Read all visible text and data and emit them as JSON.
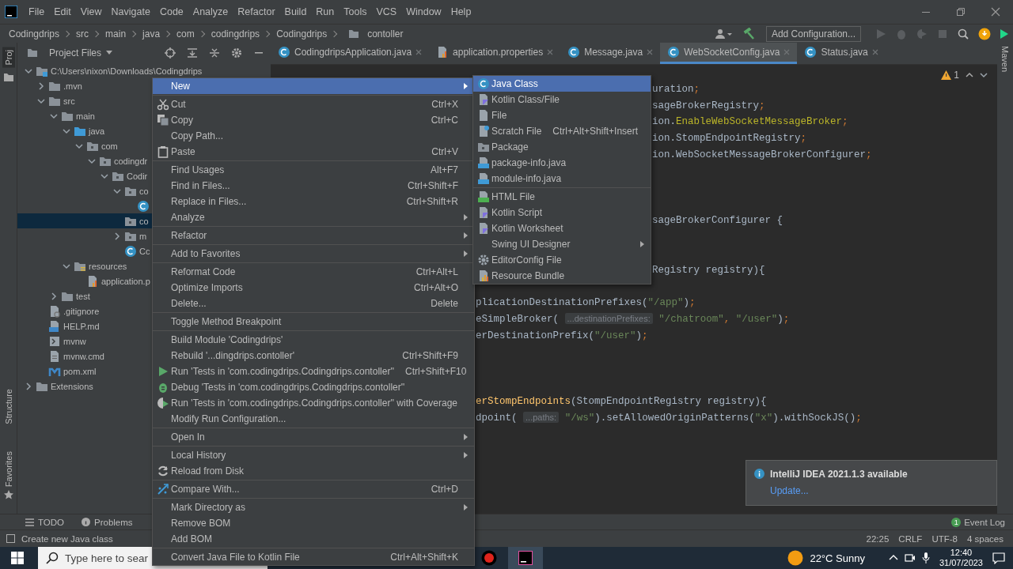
{
  "title_bar": {
    "menus": [
      "File",
      "Edit",
      "View",
      "Navigate",
      "Code",
      "Analyze",
      "Refactor",
      "Build",
      "Run",
      "Tools",
      "VCS",
      "Window",
      "Help"
    ]
  },
  "nav_bar": {
    "breadcrumb": [
      "Codingdrips",
      "src",
      "main",
      "java",
      "com",
      "codingdrips",
      "Codingdrips",
      "contoller"
    ],
    "run_config": "Add Configuration..."
  },
  "side_tabs": {
    "left": [
      "Proj",
      "Structure",
      "Favorites"
    ],
    "right": [
      "Maven"
    ]
  },
  "project_panel": {
    "title": "Project Files",
    "tree": [
      {
        "label": "C:\\Users\\nixon\\Downloads\\Codingdrips",
        "kind": "module",
        "expanded": true,
        "selected": false,
        "children": [
          {
            "label": ".mvn",
            "kind": "folder",
            "expanded": false,
            "selected": false
          },
          {
            "label": "src",
            "kind": "folder",
            "expanded": true,
            "selected": false,
            "children": [
              {
                "label": "main",
                "kind": "folder",
                "expanded": true,
                "selected": false,
                "children": [
                  {
                    "label": "java",
                    "kind": "source_folder",
                    "expanded": true,
                    "selected": false,
                    "children": [
                      {
                        "label": "com",
                        "kind": "package",
                        "expanded": true,
                        "selected": false,
                        "children": [
                          {
                            "label": "codingdr",
                            "kind": "package",
                            "expanded": true,
                            "selected": false,
                            "children": [
                              {
                                "label": "Codir",
                                "kind": "package",
                                "expanded": true,
                                "selected": false,
                                "children": [
                                  {
                                    "label": "co",
                                    "kind": "package",
                                    "expanded": true,
                                    "selected": false,
                                    "children": [
                                      {
                                        "kind": "class",
                                        "selected": false
                                      }
                                    ]
                                  },
                                  {
                                    "label": "co",
                                    "kind": "package",
                                    "selected": true
                                  },
                                  {
                                    "label": "m",
                                    "kind": "package",
                                    "expanded": false,
                                    "selected": false
                                  },
                                  {
                                    "label": "Cc",
                                    "kind": "class",
                                    "selected": false
                                  }
                                ]
                              }
                            ]
                          }
                        ]
                      }
                    ]
                  },
                  {
                    "label": "resources",
                    "kind": "resources",
                    "expanded": true,
                    "selected": false,
                    "children": [
                      {
                        "label": "application.p",
                        "kind": "properties",
                        "selected": false
                      }
                    ]
                  }
                ]
              },
              {
                "label": "test",
                "kind": "folder",
                "expanded": false,
                "selected": false
              }
            ]
          },
          {
            "label": ".gitignore",
            "kind": "ignore",
            "selected": false
          },
          {
            "label": "HELP.md",
            "kind": "markdown",
            "selected": false
          },
          {
            "label": "mvnw",
            "kind": "script",
            "selected": false
          },
          {
            "label": "mvnw.cmd",
            "kind": "text",
            "selected": false
          },
          {
            "label": "pom.xml",
            "kind": "maven",
            "selected": false
          }
        ]
      },
      {
        "label": "Extensions",
        "kind": "folder",
        "expanded": false,
        "selected": false
      }
    ]
  },
  "editor": {
    "tabs": [
      {
        "label": "CodingdripsApplication.java",
        "kind": "class",
        "selected": false
      },
      {
        "label": "application.properties",
        "kind": "properties",
        "selected": false
      },
      {
        "label": "Message.java",
        "kind": "class",
        "selected": false
      },
      {
        "label": "WebSocketConfig.java",
        "kind": "class",
        "selected": true
      },
      {
        "label": "Status.java",
        "kind": "class",
        "selected": false
      }
    ],
    "warning_count": "1",
    "lines": [
      {
        "kind": "blank"
      },
      {
        "kind": "after_submenu",
        "segments": [
          {
            "kind": "plain",
            "text": "uration"
          },
          {
            "kind": "punct",
            "text": ";"
          }
        ]
      },
      {
        "kind": "after_submenu",
        "segments": [
          {
            "kind": "plain",
            "text": "sageBrokerRegistry"
          },
          {
            "kind": "punct",
            "text": ";"
          }
        ]
      },
      {
        "kind": "after_submenu",
        "segments": [
          {
            "kind": "plain",
            "text": "ion."
          },
          {
            "kind": "annotation",
            "text": "EnableWebSocketMessageBroker"
          },
          {
            "kind": "punct",
            "text": ";"
          }
        ]
      },
      {
        "kind": "after_submenu",
        "segments": [
          {
            "kind": "plain",
            "text": "ion.StompEndpointRegistry"
          },
          {
            "kind": "punct",
            "text": ";"
          }
        ]
      },
      {
        "kind": "after_submenu",
        "segments": [
          {
            "kind": "plain",
            "text": "ion.WebSocketMessageBrokerConfigurer"
          },
          {
            "kind": "punct",
            "text": ";"
          }
        ]
      },
      {
        "kind": "blank"
      },
      {
        "kind": "blank"
      },
      {
        "kind": "blank"
      },
      {
        "kind": "after_submenu",
        "segments": [
          {
            "kind": "plain",
            "text": "sageBrokerConfigurer {"
          }
        ]
      },
      {
        "kind": "blank"
      },
      {
        "kind": "blank"
      },
      {
        "kind": "after_submenu",
        "segments": [
          {
            "kind": "plain",
            "text": "Registry registry){"
          }
        ]
      },
      {
        "kind": "blank"
      },
      {
        "kind": "after_menu",
        "segments": [
          {
            "kind": "plain",
            "text": "plicationDestinationPrefixes("
          },
          {
            "kind": "string",
            "text": "\"/app\""
          },
          {
            "kind": "plain",
            "text": ")"
          },
          {
            "kind": "punct",
            "text": ";"
          }
        ]
      },
      {
        "kind": "after_menu",
        "segments": [
          {
            "kind": "plain",
            "text": "eSimpleBroker( "
          },
          {
            "kind": "hint",
            "text": "...destinationPrefixes:"
          },
          {
            "kind": "string",
            "text": " \"/chatroom\""
          },
          {
            "kind": "punct",
            "text": ","
          },
          {
            "kind": "string",
            "text": " \"/user\""
          },
          {
            "kind": "plain",
            "text": ")"
          },
          {
            "kind": "punct",
            "text": ";"
          }
        ]
      },
      {
        "kind": "after_menu",
        "segments": [
          {
            "kind": "plain",
            "text": "erDestinationPrefix("
          },
          {
            "kind": "string",
            "text": "\"/user\""
          },
          {
            "kind": "plain",
            "text": ")"
          },
          {
            "kind": "punct",
            "text": ";"
          }
        ]
      },
      {
        "kind": "blank"
      },
      {
        "kind": "blank"
      },
      {
        "kind": "blank"
      },
      {
        "kind": "after_menu",
        "segments": [
          {
            "kind": "method",
            "text": "erStompEndpoints"
          },
          {
            "kind": "plain",
            "text": "(StompEndpointRegistry registry){"
          }
        ]
      },
      {
        "kind": "after_menu",
        "segments": [
          {
            "kind": "plain",
            "text": "dpoint( "
          },
          {
            "kind": "hint",
            "text": "...paths:"
          },
          {
            "kind": "string",
            "text": " \"/ws\""
          },
          {
            "kind": "plain",
            "text": ").setAllowedOriginPatterns("
          },
          {
            "kind": "string",
            "text": "\"x\""
          },
          {
            "kind": "plain",
            "text": ").withSockJS()"
          },
          {
            "kind": "punct",
            "text": ";"
          }
        ]
      }
    ]
  },
  "context_menu": {
    "items": [
      {
        "kind": "plain",
        "label": "New",
        "submenu": true,
        "selected": true,
        "disabled": false
      },
      {
        "kind": "separator"
      },
      {
        "kind": "cut",
        "label": "Cut",
        "shortcut": "Ctrl+X",
        "submenu": false,
        "selected": false,
        "disabled": false
      },
      {
        "kind": "copy",
        "label": "Copy",
        "shortcut": "Ctrl+C",
        "submenu": false,
        "selected": false,
        "disabled": false
      },
      {
        "kind": "plain",
        "label": "Copy Path...",
        "submenu": false,
        "selected": false,
        "disabled": false
      },
      {
        "kind": "paste",
        "label": "Paste",
        "shortcut": "Ctrl+V",
        "submenu": false,
        "selected": false,
        "disabled": false
      },
      {
        "kind": "separator"
      },
      {
        "kind": "plain",
        "label": "Find Usages",
        "shortcut": "Alt+F7",
        "submenu": false,
        "selected": false,
        "disabled": false
      },
      {
        "kind": "plain",
        "label": "Find in Files...",
        "shortcut": "Ctrl+Shift+F",
        "submenu": false,
        "selected": false,
        "disabled": false
      },
      {
        "kind": "plain",
        "label": "Replace in Files...",
        "shortcut": "Ctrl+Shift+R",
        "submenu": false,
        "selected": false,
        "disabled": false
      },
      {
        "kind": "plain",
        "label": "Analyze",
        "submenu": true,
        "selected": false,
        "disabled": false
      },
      {
        "kind": "separator"
      },
      {
        "kind": "plain",
        "label": "Refactor",
        "submenu": true,
        "selected": false,
        "disabled": false
      },
      {
        "kind": "separator"
      },
      {
        "kind": "plain",
        "label": "Add to Favorites",
        "submenu": true,
        "selected": false,
        "disabled": false
      },
      {
        "kind": "separator"
      },
      {
        "kind": "plain",
        "label": "Reformat Code",
        "shortcut": "Ctrl+Alt+L",
        "submenu": false,
        "selected": false,
        "disabled": false
      },
      {
        "kind": "plain",
        "label": "Optimize Imports",
        "shortcut": "Ctrl+Alt+O",
        "submenu": false,
        "selected": false,
        "disabled": false
      },
      {
        "kind": "plain",
        "label": "Delete...",
        "shortcut": "Delete",
        "submenu": false,
        "selected": false,
        "disabled": false
      },
      {
        "kind": "separator"
      },
      {
        "kind": "plain",
        "label": "Toggle Method Breakpoint",
        "submenu": false,
        "selected": false,
        "disabled": false
      },
      {
        "kind": "separator"
      },
      {
        "kind": "plain",
        "label": "Build Module 'Codingdrips'",
        "submenu": false,
        "selected": false,
        "disabled": false
      },
      {
        "kind": "plain",
        "label": "Rebuild '...dingdrips.contoller'",
        "shortcut": "Ctrl+Shift+F9",
        "submenu": false,
        "selected": false,
        "disabled": false
      },
      {
        "kind": "run",
        "label": "Run 'Tests in 'com.codingdrips.Codingdrips.contoller''",
        "shortcut": "Ctrl+Shift+F10",
        "submenu": false,
        "selected": false,
        "disabled": false
      },
      {
        "kind": "debug",
        "label": "Debug 'Tests in 'com.codingdrips.Codingdrips.contoller''",
        "submenu": false,
        "selected": false,
        "disabled": false
      },
      {
        "kind": "coverage",
        "label": "Run 'Tests in 'com.codingdrips.Codingdrips.contoller'' with Coverage",
        "submenu": false,
        "selected": false,
        "disabled": false
      },
      {
        "kind": "plain",
        "label": "Modify Run Configuration...",
        "submenu": false,
        "selected": false,
        "disabled": false
      },
      {
        "kind": "separator"
      },
      {
        "kind": "plain",
        "label": "Open In",
        "submenu": true,
        "selected": false,
        "disabled": false
      },
      {
        "kind": "separator"
      },
      {
        "kind": "plain",
        "label": "Local History",
        "submenu": true,
        "selected": false,
        "disabled": false
      },
      {
        "kind": "reload",
        "label": "Reload from Disk",
        "submenu": false,
        "selected": false,
        "disabled": false
      },
      {
        "kind": "separator"
      },
      {
        "kind": "compare",
        "label": "Compare With...",
        "shortcut": "Ctrl+D",
        "submenu": false,
        "selected": false,
        "disabled": false
      },
      {
        "kind": "separator"
      },
      {
        "kind": "plain",
        "label": "Mark Directory as",
        "submenu": true,
        "selected": false,
        "disabled": false
      },
      {
        "kind": "plain",
        "label": "Remove BOM",
        "submenu": false,
        "selected": false,
        "disabled": false
      },
      {
        "kind": "plain",
        "label": "Add BOM",
        "submenu": false,
        "selected": false,
        "disabled": false
      },
      {
        "kind": "separator"
      },
      {
        "kind": "plain",
        "label": "Convert Java File to Kotlin File",
        "shortcut": "Ctrl+Alt+Shift+K",
        "submenu": false,
        "selected": false,
        "disabled": false
      }
    ]
  },
  "new_submenu": {
    "items": [
      {
        "kind": "class",
        "label": "Java Class",
        "submenu": false,
        "selected": true,
        "disabled": false
      },
      {
        "kind": "kotlin",
        "label": "Kotlin Class/File",
        "submenu": false,
        "selected": false,
        "disabled": false
      },
      {
        "kind": "file",
        "label": "File",
        "submenu": false,
        "selected": false,
        "disabled": false
      },
      {
        "kind": "scratch",
        "label": "Scratch File",
        "shortcut": "Ctrl+Alt+Shift+Insert",
        "submenu": false,
        "selected": false,
        "disabled": false
      },
      {
        "kind": "package",
        "label": "Package",
        "submenu": false,
        "selected": false,
        "disabled": false
      },
      {
        "kind": "javainfo",
        "label": "package-info.java",
        "submenu": false,
        "selected": false,
        "disabled": false
      },
      {
        "kind": "javainfo",
        "label": "module-info.java",
        "submenu": false,
        "selected": false,
        "disabled": false
      },
      {
        "kind": "separator"
      },
      {
        "kind": "html",
        "label": "HTML File",
        "submenu": false,
        "selected": false,
        "disabled": false
      },
      {
        "kind": "kotlin",
        "label": "Kotlin Script",
        "submenu": false,
        "selected": false,
        "disabled": false
      },
      {
        "kind": "kotlin",
        "label": "Kotlin Worksheet",
        "submenu": false,
        "selected": false,
        "disabled": false
      },
      {
        "kind": "plain",
        "label": "Swing UI Designer",
        "submenu": true,
        "selected": false,
        "disabled": false
      },
      {
        "kind": "gear",
        "label": "EditorConfig File",
        "submenu": false,
        "selected": false,
        "disabled": false
      },
      {
        "kind": "bundle",
        "label": "Resource Bundle",
        "submenu": false,
        "selected": false,
        "disabled": false
      }
    ]
  },
  "tool_strip": {
    "tabs": [
      "TODO",
      "Problems"
    ],
    "event_log": "Event Log",
    "event_count": "1"
  },
  "status_bar": {
    "message": "Create new Java class",
    "items": [
      "22:25",
      "CRLF",
      "UTF-8",
      "4 spaces"
    ]
  },
  "notification": {
    "title": "IntelliJ IDEA 2021.1.3 available",
    "link": "Update..."
  },
  "taskbar": {
    "search_placeholder": "Type here to sear",
    "weather": "22°C Sunny",
    "time": "12:40",
    "date": "31/07/2023"
  }
}
